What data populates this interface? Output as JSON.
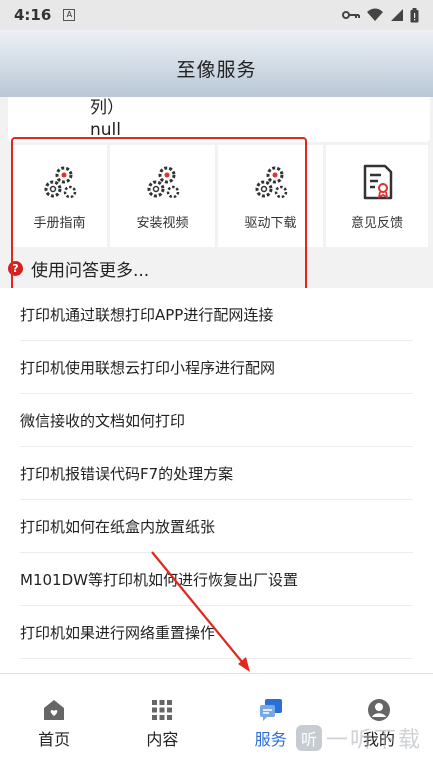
{
  "status_bar": {
    "time": "4:16",
    "app_badge": "A"
  },
  "header": {
    "title": "至像服务"
  },
  "partial_card": {
    "line1": "列）",
    "line2": "null"
  },
  "shortcuts": [
    {
      "label": "手册指南",
      "icon": "gears-icon"
    },
    {
      "label": "安装视频",
      "icon": "gears-icon"
    },
    {
      "label": "驱动下载",
      "icon": "gears-icon"
    },
    {
      "label": "意见反馈",
      "icon": "feedback-document-icon"
    }
  ],
  "more_link": {
    "badge": "?",
    "label": "使用问答更多..."
  },
  "faq": [
    "打印机通过联想打印APP进行配网连接",
    "打印机使用联想云打印小程序进行配网",
    "微信接收的文档如何打印",
    "打印机报错误代码F7的处理方案",
    "打印机如何在纸盒内放置纸张",
    "M101DW等打印机如何进行恢复出厂设置",
    "打印机如果进行网络重置操作"
  ],
  "tabs": [
    {
      "label": "首页",
      "icon": "home-icon",
      "active": false
    },
    {
      "label": "内容",
      "icon": "grid-icon",
      "active": false
    },
    {
      "label": "服务",
      "icon": "service-chat-icon",
      "active": true
    },
    {
      "label": "我的",
      "icon": "profile-icon",
      "active": false
    }
  ],
  "watermark": {
    "logo": "听",
    "text": "一听下载"
  },
  "colors": {
    "accent": "#2a6fd6",
    "annotation_red": "#e0281e"
  }
}
